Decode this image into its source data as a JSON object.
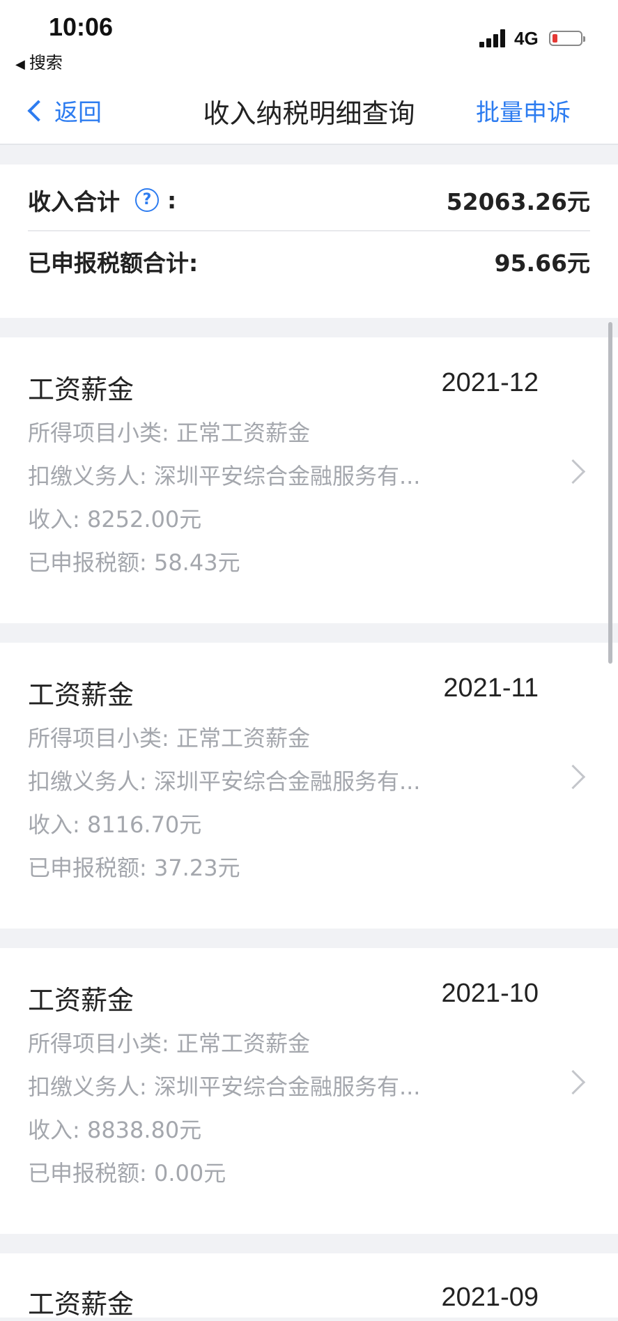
{
  "status_bar": {
    "time": "10:06",
    "back_app": "搜索",
    "network": "4G"
  },
  "nav": {
    "back_label": "返回",
    "title": "收入纳税明细查询",
    "action_label": "批量申诉"
  },
  "summary": {
    "income_label": "收入合计",
    "income_colon": ":",
    "income_value": "52063.26元",
    "tax_label": "已申报税额合计:",
    "tax_value": "95.66元"
  },
  "records": [
    {
      "type": "工资薪金",
      "date": "2021-12",
      "subcategory": "所得项目小类: 正常工资薪金",
      "withholder": "扣缴义务人: 深圳平安综合金融服务有...",
      "income": "收入: 8252.00元",
      "tax": "已申报税额: 58.43元"
    },
    {
      "type": "工资薪金",
      "date": "2021-11",
      "subcategory": "所得项目小类: 正常工资薪金",
      "withholder": "扣缴义务人: 深圳平安综合金融服务有...",
      "income": "收入: 8116.70元",
      "tax": "已申报税额: 37.23元"
    },
    {
      "type": "工资薪金",
      "date": "2021-10",
      "subcategory": "所得项目小类: 正常工资薪金",
      "withholder": "扣缴义务人: 深圳平安综合金融服务有...",
      "income": "收入: 8838.80元",
      "tax": "已申报税额: 0.00元"
    },
    {
      "type": "工资薪金",
      "date": "2021-09"
    }
  ],
  "colors": {
    "accent": "#2d7cf0",
    "background": "#f1f2f5",
    "muted_text": "#a4a7ad",
    "battery_low": "#e53935"
  }
}
